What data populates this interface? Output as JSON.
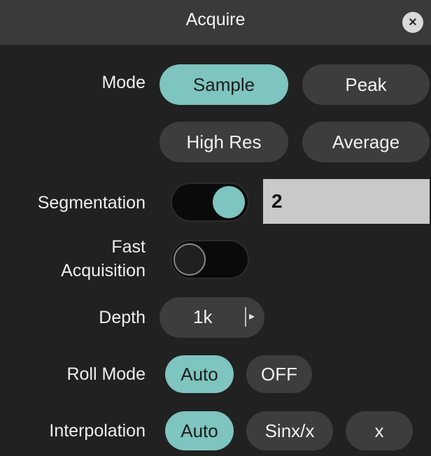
{
  "dialog": {
    "title": "Acquire",
    "close_icon": "close-icon"
  },
  "mode": {
    "label": "Mode",
    "options": [
      "Sample",
      "Peak",
      "High Res",
      "Average"
    ],
    "selected": "Sample"
  },
  "segmentation": {
    "label": "Segmentation",
    "enabled": true,
    "value": "2"
  },
  "fast_acquisition": {
    "label_line1": "Fast",
    "label_line2": "Acquisition",
    "enabled": false
  },
  "depth": {
    "label": "Depth",
    "value": "1k",
    "arrow_icon": "triangle-right-icon"
  },
  "roll_mode": {
    "label": "Roll Mode",
    "options": [
      "Auto",
      "OFF"
    ],
    "selected": "Auto"
  },
  "interpolation": {
    "label": "Interpolation",
    "options": [
      "Auto",
      "Sinx/x",
      "x"
    ],
    "selected": "Auto"
  },
  "colors": {
    "accent": "#7ec4bf",
    "pill_bg": "#3d3d3d",
    "title_bar": "#3a3a3a",
    "background": "#212121"
  }
}
